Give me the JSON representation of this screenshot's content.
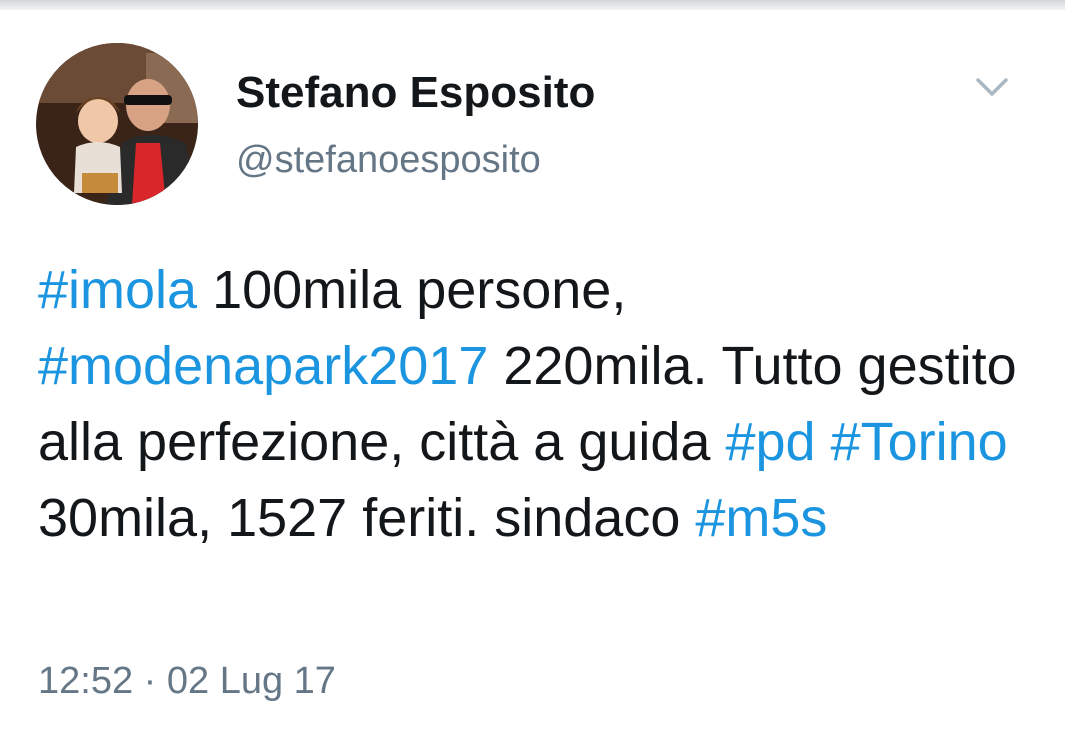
{
  "author": {
    "display_name": "Stefano Esposito",
    "handle": "@stefanoesposito"
  },
  "icons": {
    "menu": "chevron-down-icon",
    "avatar": "profile-photo"
  },
  "colors": {
    "hashtag": "#1b95e0",
    "text": "#14171a",
    "muted": "#657786"
  },
  "tweet": {
    "segments": [
      {
        "text": "#imola",
        "type": "hashtag"
      },
      {
        "text": " 100mila persone, ",
        "type": "text"
      },
      {
        "text": "#modenapark2017",
        "type": "hashtag"
      },
      {
        "text": " 220mila. Tutto gestito alla perfezione, città a guida ",
        "type": "text"
      },
      {
        "text": "#pd",
        "type": "hashtag"
      },
      {
        "text": " ",
        "type": "text"
      },
      {
        "text": "#Torino",
        "type": "hashtag"
      },
      {
        "text": " 30mila, 1527 feriti. sindaco ",
        "type": "text"
      },
      {
        "text": "#m5s",
        "type": "hashtag"
      }
    ],
    "timestamp": "12:52 · 02 Lug 17"
  }
}
